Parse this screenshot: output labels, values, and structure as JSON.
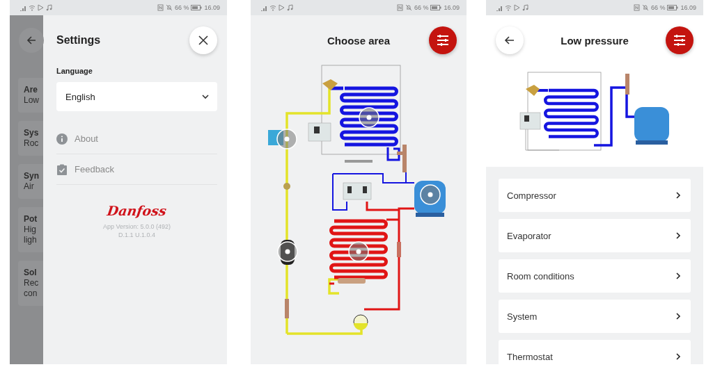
{
  "settings_screen": {
    "status_bar": {
      "battery": "66 %",
      "time": "16.09"
    },
    "background_cards": [
      {
        "lines": [
          "Are",
          "Low"
        ]
      },
      {
        "lines": [
          "Sys",
          "Roc"
        ]
      },
      {
        "lines": [
          "Syn",
          "Air"
        ]
      },
      {
        "lines": [
          "Pot",
          "Hig",
          "ligh"
        ]
      },
      {
        "lines": [
          "Sol",
          "Rec",
          "con"
        ]
      }
    ],
    "drawer": {
      "title": "Settings",
      "language_label": "Language",
      "language_value": "English",
      "menu_items": [
        {
          "kind": "info",
          "label": "About"
        },
        {
          "kind": "feedback",
          "label": "Feedback"
        }
      ],
      "logo": "Danfoss",
      "version_lines": [
        "App Version:  5.0.0 (492)",
        "D.1.1 U.1.0.4"
      ]
    }
  },
  "choose_area_screen": {
    "status_bar": {
      "battery": "66 %",
      "time": "16.09"
    },
    "title": "Choose area"
  },
  "low_pressure_screen": {
    "status_bar": {
      "battery": "66 %",
      "time": "16.09"
    },
    "title": "Low pressure",
    "items": [
      {
        "label": "Compressor"
      },
      {
        "label": "Evaporator"
      },
      {
        "label": "Room conditions"
      },
      {
        "label": "System"
      },
      {
        "label": "Thermostat"
      }
    ]
  }
}
